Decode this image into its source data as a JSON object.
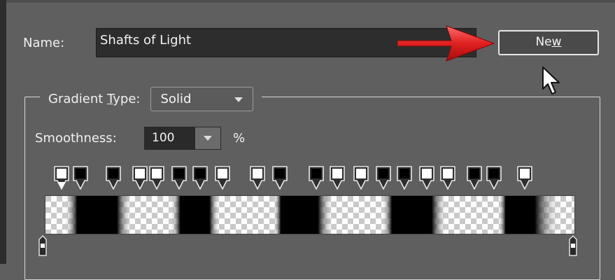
{
  "gradient_editor": {
    "name_label": "Name:",
    "name_value": "Shafts of Light",
    "new_button": {
      "prefix": "Ne",
      "underlined": "w"
    },
    "gradient_type": {
      "label_prefix": "Gradient ",
      "label_underlined": "T",
      "label_suffix": "ype:",
      "selected": "Solid"
    },
    "smoothness": {
      "label": "Smoothness:",
      "value": "100",
      "unit": "%"
    },
    "color_stops": [
      "white",
      "black",
      "black",
      "white",
      "white",
      "black",
      "black",
      "white",
      "white",
      "black",
      "black",
      "white",
      "white",
      "black",
      "black",
      "white",
      "white",
      "black",
      "black",
      "white"
    ],
    "colors": {
      "panel": "#5f5f5f",
      "field": "#2d2d2d",
      "arrow": "#e02020"
    }
  }
}
